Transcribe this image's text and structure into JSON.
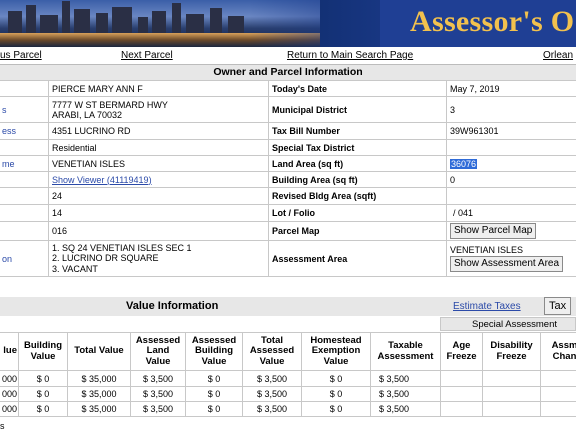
{
  "banner": {
    "title": "Assessor's O"
  },
  "nav": {
    "previous": "us Parcel",
    "next": "Next Parcel",
    "return": "Return to Main Search Page",
    "orleans": "Orlean"
  },
  "owner_section": {
    "header": "Owner and Parcel Information",
    "rows": [
      {
        "left_label": "",
        "left_value": "PIERCE MARY ANN F",
        "right_label": "Today's Date",
        "right_value": "May 7, 2019"
      },
      {
        "left_label": "s",
        "left_value_1": "7777 W ST BERMARD HWY",
        "left_value_2": "ARABI, LA 70032",
        "right_label": "Municipal District",
        "right_value": "3"
      },
      {
        "left_label": "ess",
        "left_value": "4351 LUCRINO RD",
        "right_label": "Tax Bill Number",
        "right_value": "39W961301"
      },
      {
        "left_label": "",
        "left_value": "Residential",
        "right_label": "Special Tax District",
        "right_value": ""
      },
      {
        "left_label": "me",
        "left_value": "VENETIAN ISLES",
        "right_label": "Land Area (sq ft)",
        "right_value": "36076"
      },
      {
        "left_label": "",
        "left_value": "Show Viewer (41119419)",
        "right_label": "Building Area (sq ft)",
        "right_value": "0"
      },
      {
        "left_label": "",
        "left_value": "24",
        "right_label": "Revised Bldg Area (sqft)",
        "right_value": ""
      },
      {
        "left_label": "",
        "left_value": "14",
        "right_label": "Lot / Folio",
        "right_value": "/ 041"
      },
      {
        "left_label": "",
        "left_value": "016",
        "right_label": "Parcel Map",
        "right_button": "Show Parcel Map"
      },
      {
        "left_label": "on",
        "left_lines": [
          "1. SQ 24 VENETIAN ISLES SEC 1",
          "2. LUCRINO DR SQUARE",
          "3. VACANT"
        ],
        "right_label": "Assessment Area",
        "right_value": "VENETIAN ISLES",
        "right_button": "Show Assessment Area"
      }
    ]
  },
  "value_section": {
    "title": "Value Information",
    "estimate_link": "Estimate Taxes",
    "tax_button": "Tax",
    "special_assessment": "Special Assessment",
    "headers": [
      "lue",
      "Building Value",
      "Total Value",
      "Assessed Land Value",
      "Assessed Building Value",
      "Total Assessed Value",
      "Homestead Exemption Value",
      "Taxable Assessment",
      "Age Freeze",
      "Disability Freeze",
      "Assm Chan"
    ],
    "rows": [
      [
        "000",
        "$ 0",
        "$ 35,000",
        "$ 3,500",
        "$ 0",
        "$ 3,500",
        "$ 0",
        "$ 3,500",
        "",
        "",
        ""
      ],
      [
        "000",
        "$ 0",
        "$ 35,000",
        "$ 3,500",
        "$ 0",
        "$ 3,500",
        "$ 0",
        "$ 3,500",
        "",
        "",
        ""
      ],
      [
        "000",
        "$ 0",
        "$ 35,000",
        "$ 3,500",
        "$ 0",
        "$ 3,500",
        "$ 0",
        "$ 3,500",
        "",
        "",
        ""
      ]
    ],
    "footer_mark": "s"
  }
}
